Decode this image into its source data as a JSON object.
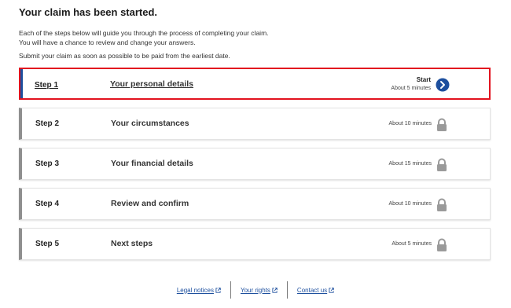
{
  "page": {
    "title": "Your claim has been started.",
    "intro_line1": "Each of the steps below will guide you through the process of completing your claim.",
    "intro_line2": "You will have a chance to review and change your answers.",
    "intro_line3": "Submit your claim as soon as possible to be paid from the earliest date."
  },
  "steps": [
    {
      "number": "Step 1",
      "title": "Your personal details",
      "status": "Start",
      "time": "About 5 minutes",
      "icon": "chevron-right-circle-icon"
    },
    {
      "number": "Step 2",
      "title": "Your circumstances",
      "status": "",
      "time": "About 10 minutes",
      "icon": "lock-icon"
    },
    {
      "number": "Step 3",
      "title": "Your financial details",
      "status": "",
      "time": "About 15 minutes",
      "icon": "lock-icon"
    },
    {
      "number": "Step 4",
      "title": "Review and confirm",
      "status": "",
      "time": "About 10 minutes",
      "icon": "lock-icon"
    },
    {
      "number": "Step 5",
      "title": "Next steps",
      "status": "",
      "time": "About 5 minutes",
      "icon": "lock-icon"
    }
  ],
  "footer": {
    "legal": "Legal notices",
    "rights": "Your rights",
    "contact": "Contact us"
  },
  "colors": {
    "link": "#1d4f9e",
    "highlight": "#e2131f",
    "locked_bar": "#8f8f8f",
    "lock": "#9a9a9a"
  }
}
